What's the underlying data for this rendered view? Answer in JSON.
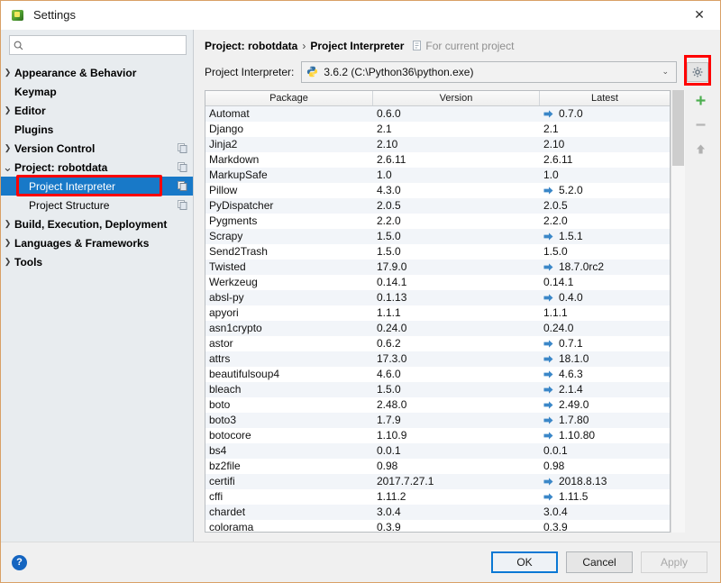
{
  "window": {
    "title": "Settings",
    "app_icon": "pycharm-icon",
    "close_icon": "close-icon"
  },
  "sidebar": {
    "search": {
      "value": "",
      "placeholder": "",
      "icon": "search-icon"
    },
    "items": [
      {
        "label": "Appearance & Behavior",
        "arrow": "›",
        "indent": 0,
        "selected": false,
        "scope_icon": false
      },
      {
        "label": "Keymap",
        "arrow": "",
        "indent": 0,
        "selected": false,
        "scope_icon": false
      },
      {
        "label": "Editor",
        "arrow": "›",
        "indent": 0,
        "selected": false,
        "scope_icon": false
      },
      {
        "label": "Plugins",
        "arrow": "",
        "indent": 0,
        "selected": false,
        "scope_icon": false
      },
      {
        "label": "Version Control",
        "arrow": "›",
        "indent": 0,
        "selected": false,
        "scope_icon": true
      },
      {
        "label": "Project: robotdata",
        "arrow": "⌄",
        "indent": 0,
        "selected": false,
        "scope_icon": true
      },
      {
        "label": "Project Interpreter",
        "arrow": "",
        "indent": 1,
        "selected": true,
        "scope_icon": true
      },
      {
        "label": "Project Structure",
        "arrow": "",
        "indent": 1,
        "selected": false,
        "scope_icon": true
      },
      {
        "label": "Build, Execution, Deployment",
        "arrow": "›",
        "indent": 0,
        "selected": false,
        "scope_icon": false
      },
      {
        "label": "Languages & Frameworks",
        "arrow": "›",
        "indent": 0,
        "selected": false,
        "scope_icon": false
      },
      {
        "label": "Tools",
        "arrow": "›",
        "indent": 0,
        "selected": false,
        "scope_icon": false
      }
    ]
  },
  "main": {
    "breadcrumb": {
      "project": "Project: robotdata",
      "separator": "›",
      "page": "Project Interpreter",
      "note": "For current project",
      "note_icon": "scope-icon"
    },
    "interpreter": {
      "label": "Project Interpreter:",
      "value": "3.6.2 (C:\\Python36\\python.exe)",
      "icon": "python-icon",
      "chevron": "⌄",
      "gear_icon": "gear-icon"
    },
    "table": {
      "columns": [
        "Package",
        "Version",
        "Latest"
      ],
      "upgrade_icon": "upgrade-arrow-icon",
      "rows": [
        {
          "package": "Automat",
          "version": "0.6.0",
          "latest": "0.7.0",
          "upgrade": true
        },
        {
          "package": "Django",
          "version": "2.1",
          "latest": "2.1",
          "upgrade": false
        },
        {
          "package": "Jinja2",
          "version": "2.10",
          "latest": "2.10",
          "upgrade": false
        },
        {
          "package": "Markdown",
          "version": "2.6.11",
          "latest": "2.6.11",
          "upgrade": false
        },
        {
          "package": "MarkupSafe",
          "version": "1.0",
          "latest": "1.0",
          "upgrade": false
        },
        {
          "package": "Pillow",
          "version": "4.3.0",
          "latest": "5.2.0",
          "upgrade": true
        },
        {
          "package": "PyDispatcher",
          "version": "2.0.5",
          "latest": "2.0.5",
          "upgrade": false
        },
        {
          "package": "Pygments",
          "version": "2.2.0",
          "latest": "2.2.0",
          "upgrade": false
        },
        {
          "package": "Scrapy",
          "version": "1.5.0",
          "latest": "1.5.1",
          "upgrade": true
        },
        {
          "package": "Send2Trash",
          "version": "1.5.0",
          "latest": "1.5.0",
          "upgrade": false
        },
        {
          "package": "Twisted",
          "version": "17.9.0",
          "latest": "18.7.0rc2",
          "upgrade": true
        },
        {
          "package": "Werkzeug",
          "version": "0.14.1",
          "latest": "0.14.1",
          "upgrade": false
        },
        {
          "package": "absl-py",
          "version": "0.1.13",
          "latest": "0.4.0",
          "upgrade": true
        },
        {
          "package": "apyori",
          "version": "1.1.1",
          "latest": "1.1.1",
          "upgrade": false
        },
        {
          "package": "asn1crypto",
          "version": "0.24.0",
          "latest": "0.24.0",
          "upgrade": false
        },
        {
          "package": "astor",
          "version": "0.6.2",
          "latest": "0.7.1",
          "upgrade": true
        },
        {
          "package": "attrs",
          "version": "17.3.0",
          "latest": "18.1.0",
          "upgrade": true
        },
        {
          "package": "beautifulsoup4",
          "version": "4.6.0",
          "latest": "4.6.3",
          "upgrade": true
        },
        {
          "package": "bleach",
          "version": "1.5.0",
          "latest": "2.1.4",
          "upgrade": true
        },
        {
          "package": "boto",
          "version": "2.48.0",
          "latest": "2.49.0",
          "upgrade": true
        },
        {
          "package": "boto3",
          "version": "1.7.9",
          "latest": "1.7.80",
          "upgrade": true
        },
        {
          "package": "botocore",
          "version": "1.10.9",
          "latest": "1.10.80",
          "upgrade": true
        },
        {
          "package": "bs4",
          "version": "0.0.1",
          "latest": "0.0.1",
          "upgrade": false
        },
        {
          "package": "bz2file",
          "version": "0.98",
          "latest": "0.98",
          "upgrade": false
        },
        {
          "package": "certifi",
          "version": "2017.7.27.1",
          "latest": "2018.8.13",
          "upgrade": true
        },
        {
          "package": "cffi",
          "version": "1.11.2",
          "latest": "1.11.5",
          "upgrade": true
        },
        {
          "package": "chardet",
          "version": "3.0.4",
          "latest": "3.0.4",
          "upgrade": false
        },
        {
          "package": "colorama",
          "version": "0.3.9",
          "latest": "0.3.9",
          "upgrade": false
        }
      ]
    },
    "tools": [
      {
        "name": "add-package-button",
        "icon": "plus-icon",
        "enabled": true
      },
      {
        "name": "remove-package-button",
        "icon": "minus-icon",
        "enabled": false
      },
      {
        "name": "upgrade-package-button",
        "icon": "up-arrow-icon",
        "enabled": false
      }
    ]
  },
  "footer": {
    "help_icon": "help-icon",
    "help_label": "?",
    "ok": "OK",
    "cancel": "Cancel",
    "apply": "Apply"
  },
  "colors": {
    "selection": "#1879c8",
    "annotation": "#ff0000",
    "upgrade_arrow": "#3b87c8",
    "add_button": "#4caf50",
    "window_border": "#d9a066"
  }
}
